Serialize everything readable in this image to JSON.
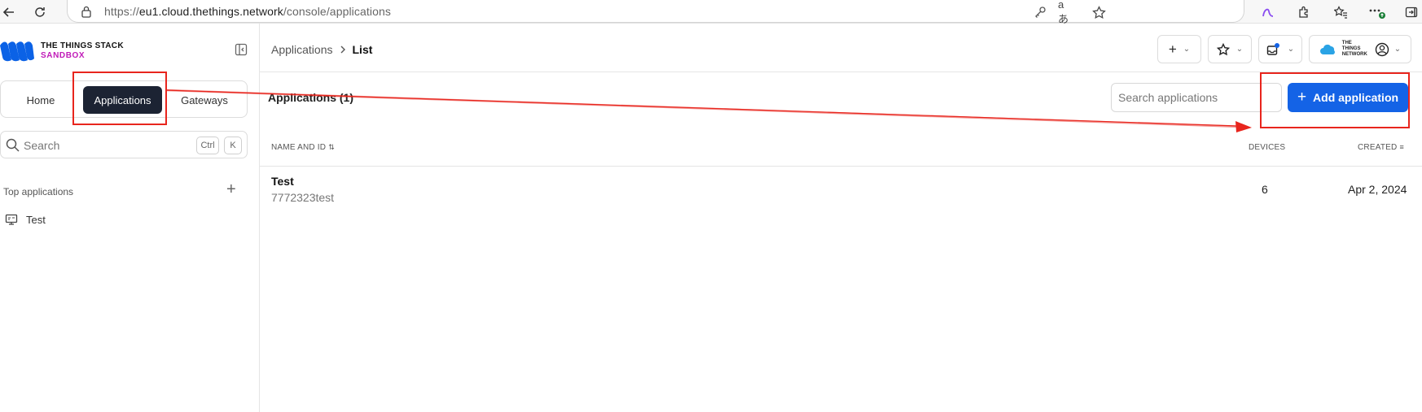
{
  "browser": {
    "url_prefix": "https://",
    "url_host": "eu1.cloud.thethings.network",
    "url_path": "/console/applications"
  },
  "sidebar": {
    "brand_line1": "THE THINGS STACK",
    "brand_line2": "SANDBOX",
    "nav": [
      {
        "label": "Home",
        "active": false
      },
      {
        "label": "Applications",
        "active": true
      },
      {
        "label": "Gateways",
        "active": false
      }
    ],
    "search": {
      "placeholder": "Search",
      "kbd1": "Ctrl",
      "kbd2": "K"
    },
    "top_apps_label": "Top applications",
    "top_apps": [
      {
        "label": "Test"
      }
    ]
  },
  "header": {
    "breadcrumb": {
      "parent": "Applications",
      "current": "List"
    },
    "brand_text": "THE THINGS NETWORK"
  },
  "main": {
    "title": "Applications (1)",
    "search_placeholder": "Search applications",
    "add_button": "Add application",
    "columns": {
      "name": "NAME AND ID",
      "devices": "DEVICES",
      "created": "CREATED"
    },
    "rows": [
      {
        "name": "Test",
        "id": "7772323test",
        "devices": "6",
        "created": "Apr 2, 2024"
      }
    ]
  },
  "colors": {
    "accent": "#1463e6",
    "active_nav": "#1c2333",
    "annotation": "#e8251d",
    "brand_magenta": "#c01ab8"
  }
}
